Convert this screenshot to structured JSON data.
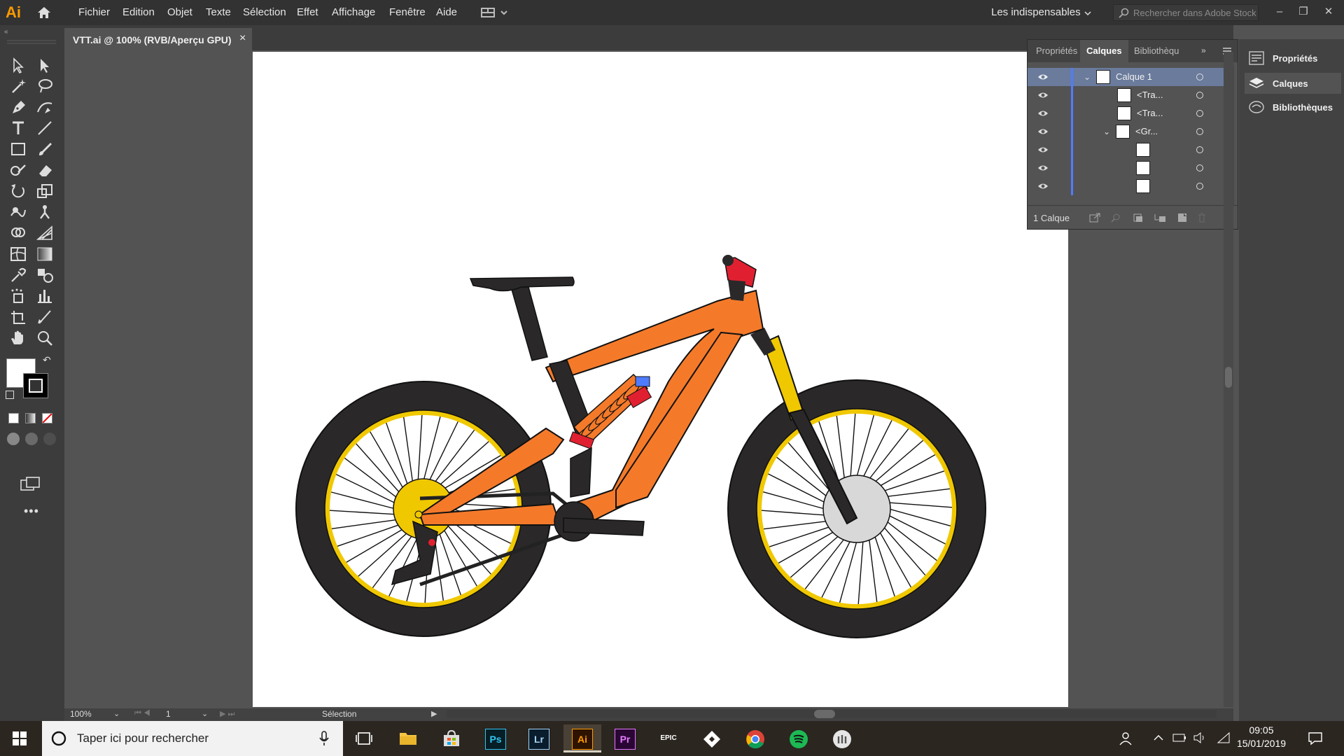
{
  "app": {
    "logo": "Ai"
  },
  "menu": [
    "Fichier",
    "Edition",
    "Objet",
    "Texte",
    "Sélection",
    "Effet",
    "Affichage",
    "Fenêtre",
    "Aide"
  ],
  "workspace": {
    "label": "Les indispensables"
  },
  "search": {
    "placeholder": "Rechercher dans Adobe Stock"
  },
  "document": {
    "tab_title": "VTT.ai @ 100% (RVB/Aperçu GPU)",
    "close": "×"
  },
  "layers_panel": {
    "tabs": [
      "Propriétés",
      "Calques",
      "Bibliothèqu"
    ],
    "active_tab": "Calques",
    "rows": [
      {
        "label": "Calque 1",
        "expanded": true,
        "selected": true
      },
      {
        "label": "<Tra..."
      },
      {
        "label": "<Tra..."
      },
      {
        "label": "<Gr...",
        "expanded": true
      },
      {
        "label": ""
      },
      {
        "label": ""
      },
      {
        "label": ""
      }
    ],
    "count_label": "1 Calque"
  },
  "right_dock": {
    "items": [
      {
        "label": "Propriétés",
        "icon": "properties-icon"
      },
      {
        "label": "Calques",
        "icon": "layers-icon",
        "active": true
      },
      {
        "label": "Bibliothèques",
        "icon": "libraries-icon"
      }
    ]
  },
  "status_bar": {
    "zoom": "100%",
    "artboard": "1",
    "tool": "Sélection"
  },
  "taskbar": {
    "search_placeholder": "Taper ici pour rechercher",
    "apps": [
      {
        "name": "task-view",
        "label": ""
      },
      {
        "name": "file-explorer",
        "label": ""
      },
      {
        "name": "store",
        "label": ""
      },
      {
        "name": "photoshop",
        "label": "Ps"
      },
      {
        "name": "lightroom",
        "label": "Lr"
      },
      {
        "name": "illustrator",
        "label": "Ai",
        "active": true
      },
      {
        "name": "premiere",
        "label": "Pr"
      },
      {
        "name": "epic-games",
        "label": "EPIC"
      },
      {
        "name": "git",
        "label": ""
      },
      {
        "name": "chrome",
        "label": ""
      },
      {
        "name": "spotify",
        "label": ""
      },
      {
        "name": "app-white",
        "label": ""
      }
    ],
    "time": "09:05",
    "date": "15/01/2019"
  },
  "colors": {
    "bike_frame": "#f47a2a",
    "bike_rim": "#f0c800",
    "tire": "#2a2828",
    "accent_blue": "#4f7cff"
  }
}
